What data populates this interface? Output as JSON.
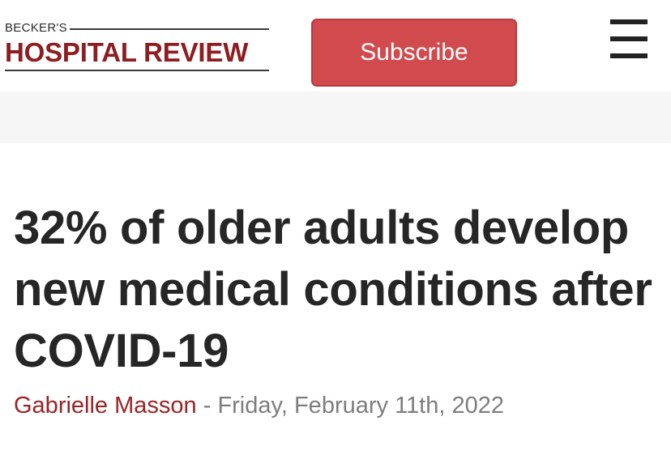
{
  "header": {
    "logo_small": "BECKER'S",
    "logo_main": "HOSPITAL REVIEW",
    "subscribe_label": "Subscribe",
    "menu_icon": "hamburger-menu-icon"
  },
  "colors": {
    "brand": "#8e1d21",
    "subscribe_bg": "#d04a4e",
    "author": "#9b2325",
    "band": "#f6f6f6"
  },
  "article": {
    "headline": "32% of older adults develop new medical conditions after COVID-19",
    "author": "Gabrielle Masson",
    "separator": " - ",
    "date": "Friday, February 11th, 2022"
  }
}
